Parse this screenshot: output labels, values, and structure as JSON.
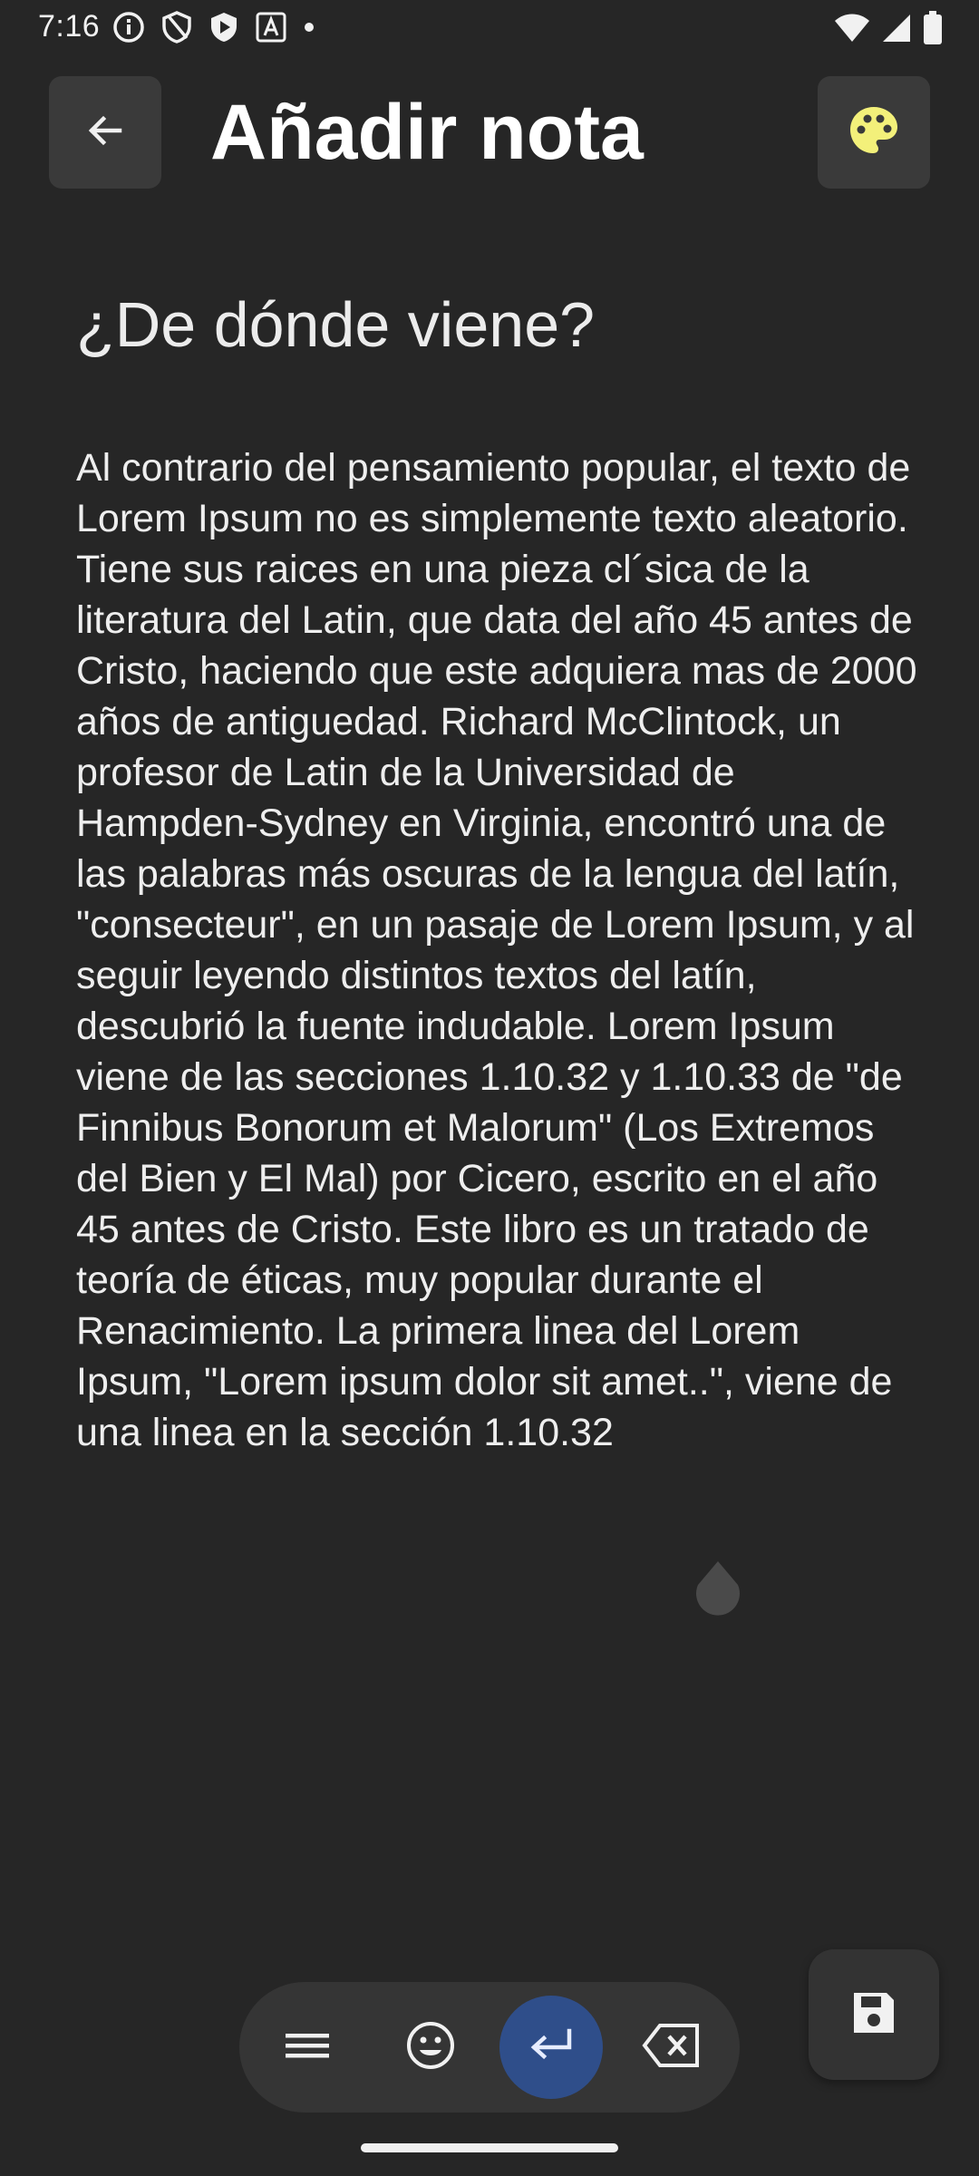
{
  "status_bar": {
    "time": "7:16",
    "left_icons": [
      "info-icon",
      "shield-icon",
      "shield-play-icon",
      "font-icon",
      "dot-icon"
    ],
    "right_icons": [
      "wifi-icon",
      "signal-icon",
      "battery-icon"
    ]
  },
  "header": {
    "title": "Añadir nota",
    "back_icon": "arrow-left-icon",
    "palette_icon": "palette-icon",
    "palette_color": "#f3f07a"
  },
  "note": {
    "title": "¿De dónde viene?",
    "body": "Al contrario del pensamiento popular, el texto de Lorem Ipsum no es simplemente texto aleatorio. Tiene sus raices en una pieza cl´sica de la literatura del Latin, que data del año 45 antes de Cristo, haciendo que este adquiera mas de 2000 años de antiguedad. Richard McClintock, un profesor de Latin de la Universidad de Hampden-Sydney en Virginia, encontró una de las palabras más oscuras de la lengua del latín, \"consecteur\", en un pasaje de Lorem Ipsum, y al seguir leyendo distintos textos del latín, descubrió la fuente indudable. Lorem Ipsum viene de las secciones 1.10.32 y 1.10.33 de \"de Finnibus Bonorum et Malorum\" (Los Extremos del Bien y El Mal) por Cicero, escrito en el año 45 antes de Cristo. Este libro es un tratado de teoría de éticas, muy popular durante el Renacimiento. La primera linea del Lorem Ipsum, \"Lorem ipsum dolor sit amet..\", viene de una linea en la sección 1.10.32"
  },
  "toolbar": {
    "items": [
      {
        "icon": "menu-icon"
      },
      {
        "icon": "emoji-icon"
      },
      {
        "icon": "enter-icon"
      },
      {
        "icon": "backspace-icon"
      }
    ],
    "active_color": "#2f4e8a"
  },
  "save_fab": {
    "icon": "save-icon"
  }
}
